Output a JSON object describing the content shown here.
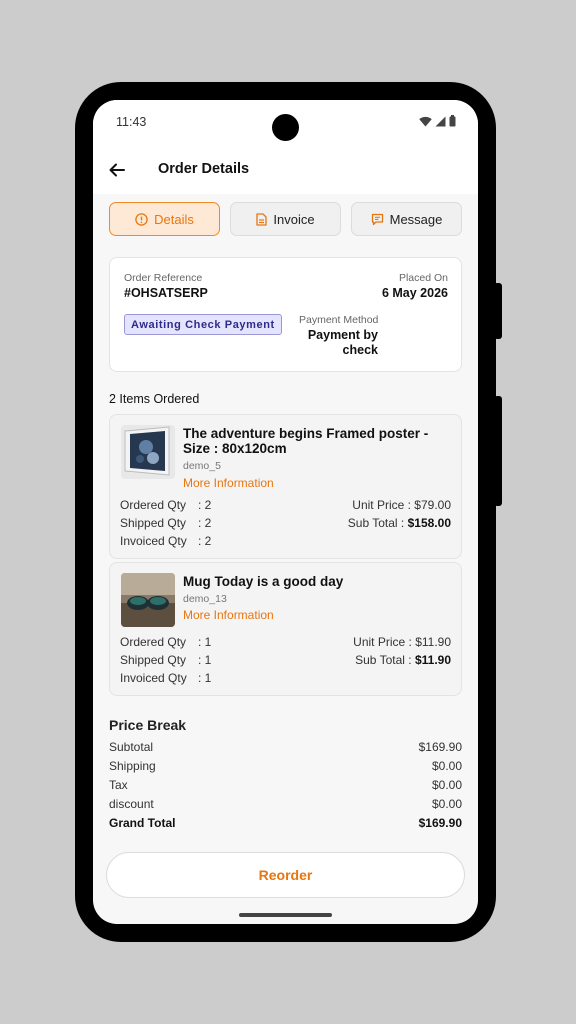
{
  "status": {
    "time": "11:43"
  },
  "appbar": {
    "title": "Order Details"
  },
  "tabs": [
    {
      "label": "Details",
      "icon": "info-icon",
      "active": true
    },
    {
      "label": "Invoice",
      "icon": "document-icon",
      "active": false
    },
    {
      "label": "Message",
      "icon": "chat-icon",
      "active": false
    }
  ],
  "order": {
    "reference_label": "Order Reference",
    "reference": "#OHSATSERP",
    "placed_label": "Placed On",
    "placed_date": "6 May 2026",
    "status_badge": "Awaiting Check Payment",
    "payment_label": "Payment Method",
    "payment_line1": "Payment by",
    "payment_line2": "check"
  },
  "items_heading": "2 Items Ordered",
  "items": [
    {
      "name_line1": "The adventure begins Framed poster -",
      "name_line2": "Size : 80x120cm",
      "ref": "demo_5",
      "more": "More Information",
      "ordered_label": "Ordered Qty",
      "ordered": ": 2",
      "shipped_label": "Shipped Qty",
      "shipped": ": 2",
      "invoiced_label": "Invoiced Qty",
      "invoiced": ": 2",
      "unit_price_label": "Unit Price : ",
      "unit_price": "$79.00",
      "subtotal_label": "Sub Total : ",
      "subtotal": "$158.00"
    },
    {
      "name_line1": "Mug Today is a good day",
      "ref": "demo_13",
      "more": "More Information",
      "ordered_label": "Ordered Qty",
      "ordered": ": 1",
      "shipped_label": "Shipped Qty",
      "shipped": ": 1",
      "invoiced_label": "Invoiced Qty",
      "invoiced": ": 1",
      "unit_price_label": "Unit Price : ",
      "unit_price": "$11.90",
      "subtotal_label": "Sub Total : ",
      "subtotal": "$11.90"
    }
  ],
  "price_break": {
    "title": "Price Break",
    "rows": [
      {
        "label": "Subtotal",
        "value": "$169.90"
      },
      {
        "label": "Shipping",
        "value": "$0.00"
      },
      {
        "label": "Tax",
        "value": "$0.00"
      },
      {
        "label": "discount",
        "value": "$0.00"
      },
      {
        "label": "Grand Total",
        "value": "$169.90"
      }
    ]
  },
  "reorder_label": "Reorder",
  "colors": {
    "accent": "#e8760f",
    "badge_bg": "#e5e4ff",
    "badge_text": "#2e2b8a"
  }
}
